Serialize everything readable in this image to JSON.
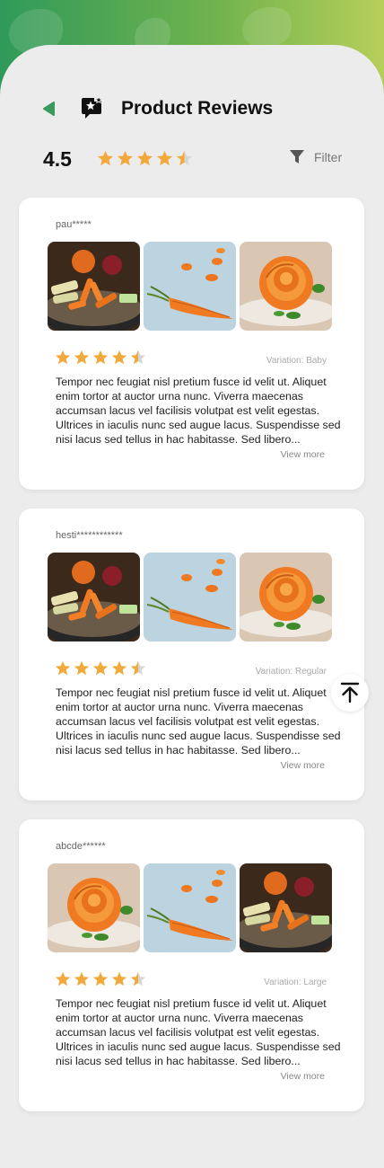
{
  "header": {
    "title": "Product Reviews",
    "back_icon": "back-arrow-icon",
    "title_icon": "review-star-bubble-icon",
    "accent_color": "#3a9a5c"
  },
  "summary": {
    "rating": "4.5",
    "stars": 4.5,
    "filter_label": "Filter",
    "filter_icon": "funnel-icon"
  },
  "colors": {
    "star": "#f2a93b",
    "star_empty": "#d6d6d6",
    "gradient_start": "#2f9a5a",
    "gradient_end": "#b6cf5a"
  },
  "reviews": [
    {
      "reviewer": "pau*****",
      "stars": 4.5,
      "variation": "Variation: Baby",
      "text": "Tempor nec feugiat nisl pretium fusce id velit ut. Aliquet enim tortor at auctor urna nunc. Viverra maecenas accumsan lacus vel facilisis volutpat est velit egestas. Ultrices in iaculis nunc sed augue lacus. Suspendisse sed nisi lacus sed tellus in hac habitasse. Sed libero...",
      "view_more": "View more",
      "photos": [
        "plate",
        "carrot",
        "rose"
      ]
    },
    {
      "reviewer": "hesti************",
      "stars": 4.5,
      "variation": "Variation: Regular",
      "text": "Tempor nec feugiat nisl pretium fusce id velit ut. Aliquet enim tortor at auctor urna nunc. Viverra maecenas accumsan lacus vel facilisis volutpat est velit egestas. Ultrices in iaculis nunc sed augue lacus. Suspendisse sed nisi lacus sed tellus in hac habitasse. Sed libero...",
      "view_more": "View more",
      "photos": [
        "plate",
        "carrot",
        "rose"
      ]
    },
    {
      "reviewer": "abcde******",
      "stars": 4.5,
      "variation": "Variation: Large",
      "text": "Tempor nec feugiat nisl pretium fusce id velit ut. Aliquet enim tortor at auctor urna nunc. Viverra maecenas accumsan lacus vel facilisis volutpat est velit egestas. Ultrices in iaculis nunc sed augue lacus. Suspendisse sed nisi lacus sed tellus in hac habitasse. Sed libero...",
      "view_more": "View more",
      "photos": [
        "rose",
        "carrot",
        "plate"
      ]
    }
  ],
  "scroll_top_icon": "arrow-up-to-top-icon"
}
